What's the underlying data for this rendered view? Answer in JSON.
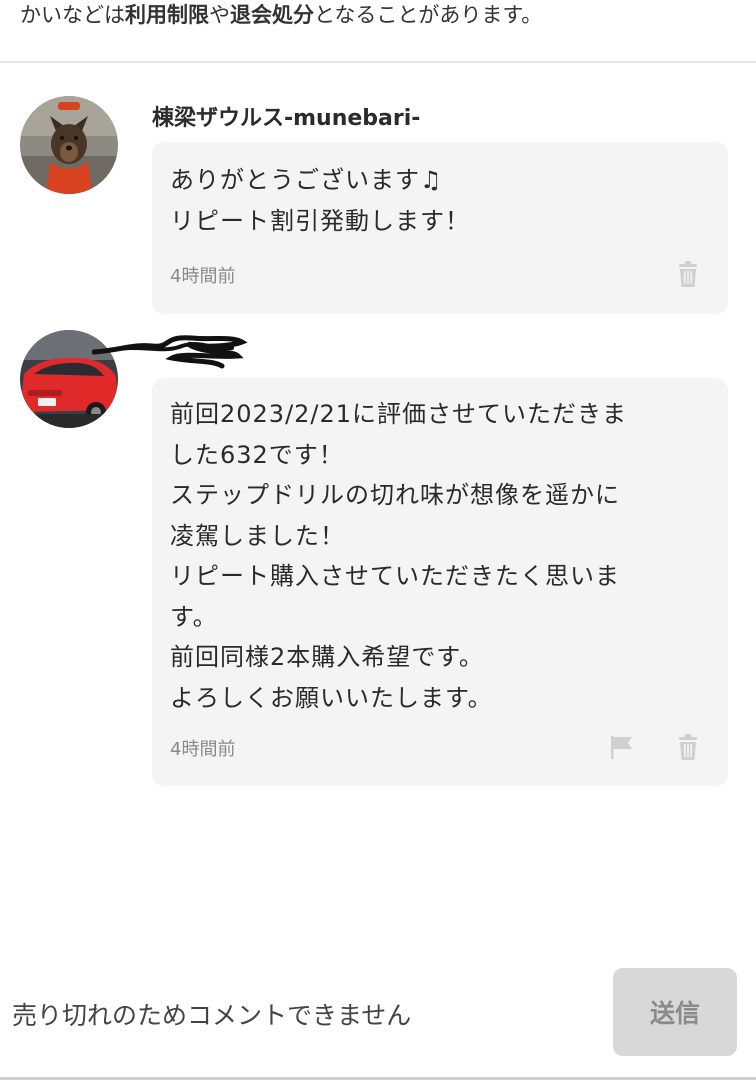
{
  "notice": {
    "pre": "かいなどは",
    "bold1": "利用制限",
    "mid": "や",
    "bold2": "退会処分",
    "post": "となることがあります。"
  },
  "comments": [
    {
      "username": "棟梁ザウルス-munebari-",
      "lines": [
        "ありがとうございます♫",
        "リピート割引発動します！"
      ],
      "time": "4時間前",
      "has_flag": false
    },
    {
      "username": "",
      "lines": [
        "前回2023/2/21に評価させていただきま",
        "した632です！",
        "ステップドリルの切れ味が想像を遥かに",
        "凌駕しました！",
        "リピート購入させていただきたく思いま",
        "す。",
        "前回同様2本購入希望です。",
        "よろしくお願いいたします。"
      ],
      "time": "4時間前",
      "has_flag": true
    }
  ],
  "bottom": {
    "sold_out_message": "売り切れのためコメントできません",
    "send_label": "送信"
  },
  "icons": {
    "trash": "trash-icon",
    "flag": "flag-icon"
  },
  "colors": {
    "bubble_bg": "#f4f4f4",
    "time_text": "#8a8a8a",
    "send_btn_bg": "#d8d8d8",
    "icon_gray": "#d0d0d0"
  }
}
